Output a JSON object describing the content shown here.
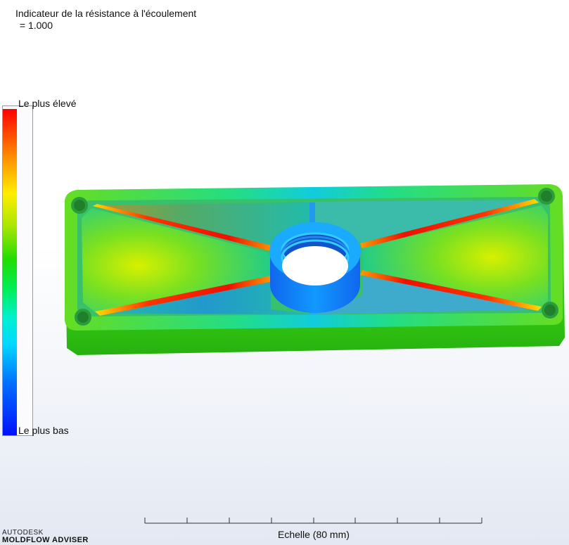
{
  "result": {
    "title": "Indicateur de la résistance à l'écoulement",
    "value": " = 1.000"
  },
  "legend": {
    "high_label": "Le plus élevé",
    "low_label": "Le plus bas"
  },
  "scale": {
    "label": "Echelle (80 mm)"
  },
  "branding": {
    "company": "AUTODESK",
    "product": "MOLDFLOW ADVISER"
  },
  "colors": {
    "high": "#ff0000",
    "mid": "#22dd00",
    "low": "#0010ff"
  }
}
